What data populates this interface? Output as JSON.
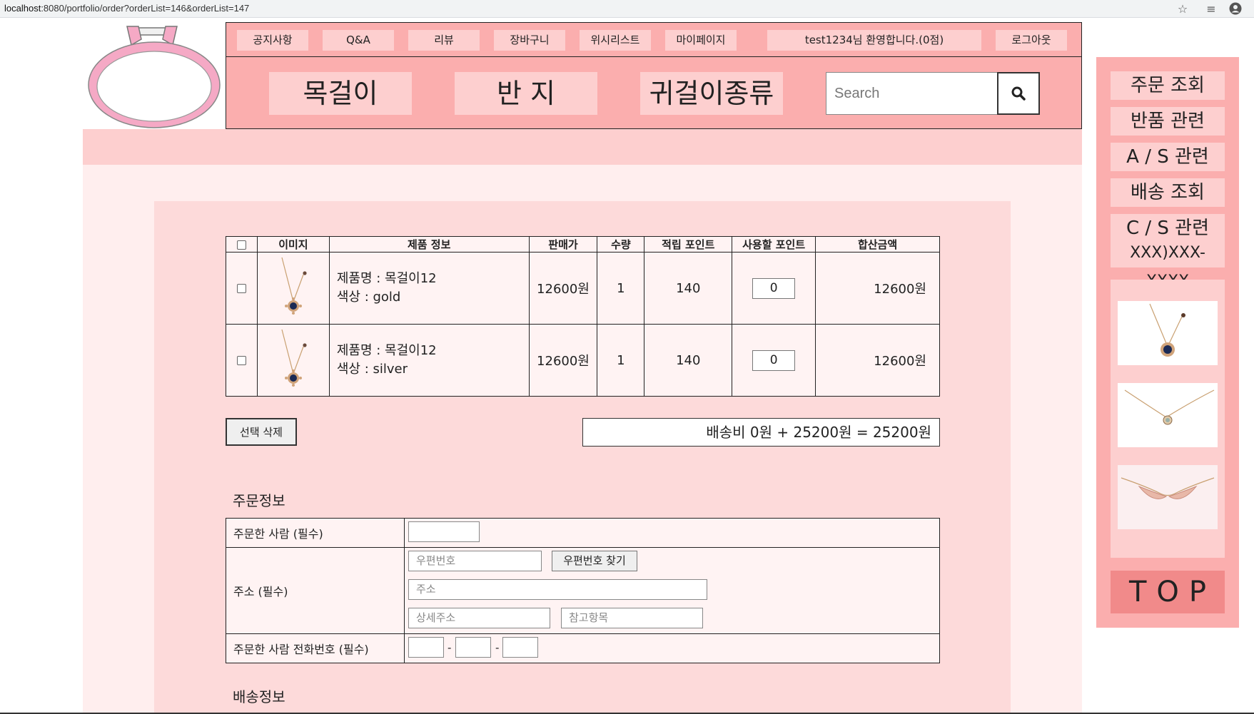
{
  "browser": {
    "url_host": "localhost",
    "url_rest": ":8080/portfolio/order?orderList=146&orderList=147"
  },
  "top_nav": [
    "공지사항",
    "Q&A",
    "리뷰",
    "장바구니",
    "위시리스트",
    "마이페이지"
  ],
  "welcome": "test1234님 환영합니다.(0점)",
  "logout": "로그아웃",
  "categories": [
    "목걸이",
    "반 지",
    "귀걸이종류"
  ],
  "search": {
    "placeholder": "Search"
  },
  "cart": {
    "headers": [
      "이미지",
      "제품 정보",
      "판매가",
      "수량",
      "적립 포인트",
      "사용할 포인트",
      "합산금액"
    ],
    "rows": [
      {
        "name": "제품명 : 목걸이12",
        "color": "색상 : gold",
        "price": "12600원",
        "qty": "1",
        "points": "140",
        "use_points": "0",
        "total": "12600원"
      },
      {
        "name": "제품명 : 목걸이12",
        "color": "색상 : silver",
        "price": "12600원",
        "qty": "1",
        "points": "140",
        "use_points": "0",
        "total": "12600원"
      }
    ],
    "delete_label": "선택 삭제",
    "summary": "배송비 0원 + 25200원 = 25200원"
  },
  "order_info": {
    "title": "주문정보",
    "orderer_label": "주문한 사람 (필수)",
    "address_label": "주소 (필수)",
    "postcode_placeholder": "우편번호",
    "find_postcode": "우편번호 찾기",
    "address_placeholder": "주소",
    "detail_placeholder": "상세주소",
    "extra_placeholder": "참고항목",
    "phone_label": "주문한 사람 전화번호 (필수)",
    "phone_sep": "-"
  },
  "shipping_title": "배송정보",
  "sidebar": {
    "items": [
      "주문 조회",
      "반품 관련",
      "A / S 관련",
      "배송 조회",
      "C / S 관련"
    ],
    "phone": "XXX)XXX-XXXX",
    "top": "TOP"
  },
  "colors": {
    "pink_dark": "#fbaeae",
    "pink_light": "#fdcfcf",
    "pink_bg": "#ffeeee",
    "top_btn": "#f18a8a"
  }
}
